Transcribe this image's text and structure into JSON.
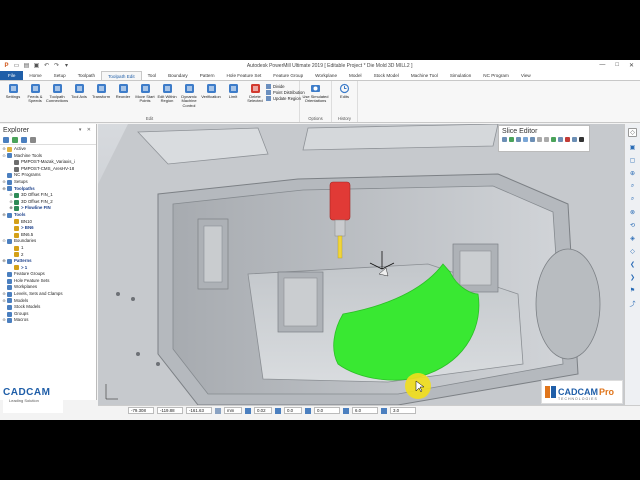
{
  "app": {
    "title": "Autodesk PowerMill Ultimate 2019   [ Editable Project * Die Mold 3D MILL2 ]",
    "window_controls": [
      "—",
      "□",
      "✕"
    ]
  },
  "ribbon_tabs": [
    "File",
    "Home",
    "Setup",
    "Toolpath",
    "Toolpath Edit",
    "Tool",
    "Boundary",
    "Pattern",
    "Hole Feature Set",
    "Feature Group",
    "Workplane",
    "Model",
    "Stock Model",
    "Machine Tool",
    "Simulation",
    "NC Program",
    "View"
  ],
  "ribbon_active_tab": "Toolpath Edit",
  "ribbon": {
    "edit_buttons": [
      {
        "label": "Settings",
        "icon": "settings-icon",
        "color": "#3d7cc9"
      },
      {
        "label": "Feeds & Speeds",
        "icon": "feeds-speeds-icon",
        "color": "#3d7cc9"
      },
      {
        "label": "Toolpath Connections",
        "icon": "connections-icon",
        "color": "#3d7cc9"
      },
      {
        "label": "Tool Axis",
        "icon": "tool-axis-icon",
        "color": "#3d7cc9"
      },
      {
        "label": "Transform",
        "icon": "transform-icon",
        "color": "#3d7cc9"
      },
      {
        "label": "Reorder",
        "icon": "reorder-icon",
        "color": "#3d7cc9"
      },
      {
        "label": "Move Start Points",
        "icon": "move-start-icon",
        "color": "#3d7cc9"
      },
      {
        "label": "Edit Within Region",
        "icon": "edit-region-icon",
        "color": "#3d7cc9"
      },
      {
        "label": "Dynamic Machine Control",
        "icon": "dynamic-control-icon",
        "color": "#3d7cc9"
      },
      {
        "label": "Verification",
        "icon": "verification-icon",
        "color": "#3d7cc9"
      },
      {
        "label": "Limit",
        "icon": "limit-icon",
        "color": "#3d7cc9"
      },
      {
        "label": "Delete Selected",
        "icon": "delete-icon",
        "color": "#d23a2f"
      }
    ],
    "edit_small": [
      "Divide",
      "Point Distribution",
      "Update Region"
    ],
    "edit_group_label": "Edit",
    "options_button": "Use Simulated Orientations",
    "options_group_label": "Options",
    "history_button": "Edits",
    "history_group_label": "History"
  },
  "explorer": {
    "title": "Explorer",
    "controls": "▾ ✕",
    "tree": [
      {
        "label": "Active",
        "level": 0,
        "icon": "folder-icon",
        "color": "#e0b23a",
        "expander": "⊕"
      },
      {
        "label": "Machine Tools",
        "level": 0,
        "icon": "machine-tool-icon",
        "color": "#4b7fbf",
        "expander": "⊖"
      },
      {
        "label": "PMPOST-Mazak_Variaxis_i",
        "level": 1,
        "icon": "machine-icon",
        "color": "#6d6d6d",
        "expander": ""
      },
      {
        "label": "PMPOST-CMS_AresHV-18",
        "level": 1,
        "icon": "machine-icon",
        "color": "#6d6d6d",
        "expander": ""
      },
      {
        "label": "NC Programs",
        "level": 0,
        "icon": "nc-program-icon",
        "color": "#4b7fbf",
        "expander": ""
      },
      {
        "label": "Setups",
        "level": 0,
        "icon": "setup-icon",
        "color": "#4b7fbf",
        "expander": "⊕"
      },
      {
        "label": "Toolpaths",
        "level": 0,
        "icon": "toolpath-icon",
        "color": "#4b7fbf",
        "expander": "⊖",
        "bold": true
      },
      {
        "label": "3D Offset FIN_1",
        "level": 1,
        "icon": "toolpath-item-icon",
        "color": "#2e8b57",
        "expander": "⊕"
      },
      {
        "label": "3D Offset FIN_2",
        "level": 1,
        "icon": "toolpath-item-icon",
        "color": "#2e8b57",
        "expander": "⊕"
      },
      {
        "label": "> Flowline FIN",
        "level": 1,
        "icon": "toolpath-active-icon",
        "color": "#2e8b57",
        "expander": "⊕",
        "bold": true
      },
      {
        "label": "Tools",
        "level": 0,
        "icon": "tool-icon",
        "color": "#4b7fbf",
        "expander": "⊖",
        "bold": true
      },
      {
        "label": "BN10",
        "level": 1,
        "icon": "tool-item-icon",
        "color": "#d4a017",
        "expander": ""
      },
      {
        "label": "> BN6",
        "level": 1,
        "icon": "tool-item-icon",
        "color": "#d4a017",
        "expander": "",
        "bold": true
      },
      {
        "label": "BN6.5",
        "level": 1,
        "icon": "tool-item-icon",
        "color": "#d4a017",
        "expander": ""
      },
      {
        "label": "Boundaries",
        "level": 0,
        "icon": "boundary-icon",
        "color": "#4b7fbf",
        "expander": "⊖"
      },
      {
        "label": "1",
        "level": 1,
        "icon": "boundary-item-icon",
        "color": "#d4a017",
        "expander": ""
      },
      {
        "label": "2",
        "level": 1,
        "icon": "boundary-item-icon",
        "color": "#d4a017",
        "expander": ""
      },
      {
        "label": "Patterns",
        "level": 0,
        "icon": "pattern-icon",
        "color": "#4b7fbf",
        "expander": "⊖",
        "bold": true
      },
      {
        "label": "> 1",
        "level": 1,
        "icon": "pattern-item-icon",
        "color": "#d4a017",
        "expander": "",
        "bold": true
      },
      {
        "label": "Feature Groups",
        "level": 0,
        "icon": "feature-group-icon",
        "color": "#4b7fbf",
        "expander": ""
      },
      {
        "label": "Hole Feature Sets",
        "level": 0,
        "icon": "hole-feature-icon",
        "color": "#4b7fbf",
        "expander": ""
      },
      {
        "label": "Workplanes",
        "level": 0,
        "icon": "workplane-icon",
        "color": "#4b7fbf",
        "expander": ""
      },
      {
        "label": "Levels, Sets and Clamps",
        "level": 0,
        "icon": "levels-icon",
        "color": "#4b7fbf",
        "expander": "⊕"
      },
      {
        "label": "Models",
        "level": 0,
        "icon": "model-icon",
        "color": "#4b7fbf",
        "expander": "⊕"
      },
      {
        "label": "Stock Models",
        "level": 0,
        "icon": "stock-model-icon",
        "color": "#4b7fbf",
        "expander": ""
      },
      {
        "label": "Groups",
        "level": 0,
        "icon": "groups-icon",
        "color": "#4b7fbf",
        "expander": ""
      },
      {
        "label": "Macros",
        "level": 0,
        "icon": "macros-icon",
        "color": "#4b7fbf",
        "expander": "⊕"
      }
    ]
  },
  "slice_editor": {
    "title": "Slice Editor"
  },
  "statusbar": {
    "coord_x": "-79.308",
    "coord_y": "-119.88",
    "coord_z": "-161.63",
    "units": "mm",
    "tolerance": "0.02",
    "thickness": "0.0",
    "axial_thickness": "0.0",
    "tool_diameter": "6.0",
    "stepover": "3.0"
  },
  "branding": {
    "left_logo": "CADCAM",
    "left_tagline": "Leading Solution",
    "right_logo": "CADCAM",
    "right_logo_pro": "Pro",
    "right_subtitle": "TECHNOLOGIES"
  },
  "colors": {
    "ribbon_file": "#1f5ea8",
    "toolpath_fill": "#39e832",
    "tool_holder": "#e13a36",
    "cursor_highlight": "#f2df1b",
    "part_gray": "#bfc3c8"
  }
}
